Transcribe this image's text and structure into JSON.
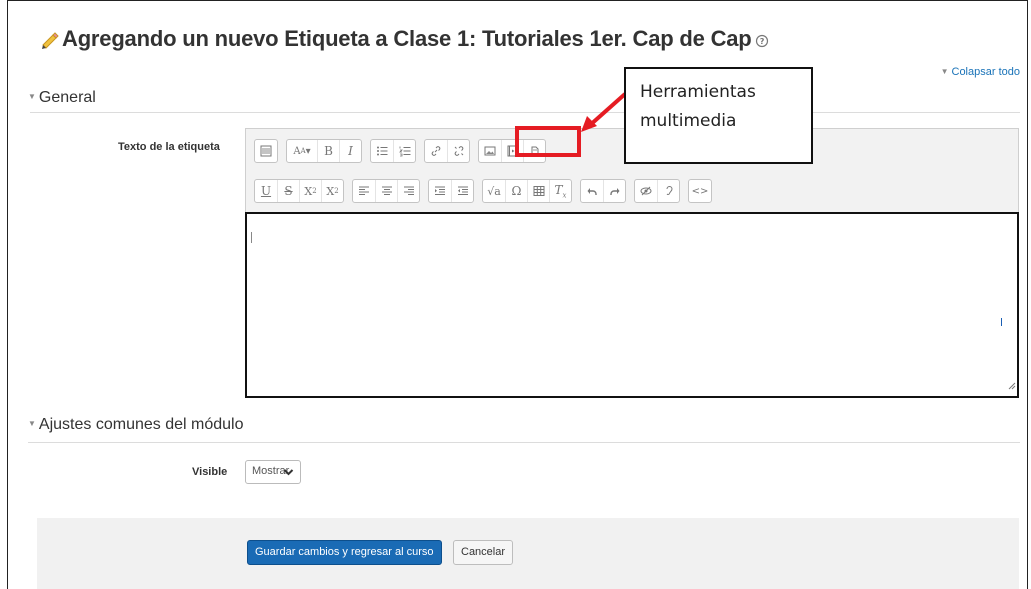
{
  "page": {
    "title": "Agregando un nuevo Etiqueta a Clase 1: Tutoriales 1er. Cap de Cap",
    "collapse_all": "Colapsar todo"
  },
  "sections": {
    "general": "General",
    "module_settings": "Ajustes comunes del módulo"
  },
  "fields": {
    "label_text": "Texto de la etiqueta",
    "visible_label": "Visible",
    "visible_value": "Mostrar",
    "editor_content": ""
  },
  "editor_toolbar": {
    "row1": [
      [
        "show-more-icon"
      ],
      [
        "font-style-icon",
        "bold-icon",
        "italic-icon"
      ],
      [
        "unordered-list-icon",
        "ordered-list-icon"
      ],
      [
        "link-icon",
        "unlink-icon"
      ],
      [
        "image-icon",
        "media-icon",
        "manage-files-icon"
      ]
    ],
    "row2": [
      [
        "underline-icon",
        "strikethrough-icon",
        "subscript-icon",
        "superscript-icon"
      ],
      [
        "align-left-icon",
        "align-center-icon",
        "align-right-icon"
      ],
      [
        "indent-icon",
        "outdent-icon"
      ],
      [
        "equation-icon",
        "special-chars-icon",
        "table-icon",
        "clear-format-icon"
      ],
      [
        "undo-icon",
        "redo-icon"
      ],
      [
        "accessibility-checker-icon",
        "screenreader-helper-icon"
      ],
      [
        "html-icon"
      ]
    ]
  },
  "buttons": {
    "save_return": "Guardar cambios y regresar al curso",
    "cancel": "Cancelar"
  },
  "annotation": {
    "line1": "Herramientas",
    "line2": "multimedia",
    "color": "#e51c23"
  },
  "colors": {
    "primary_button": "#1a6bb5",
    "link": "#1a73b8"
  }
}
